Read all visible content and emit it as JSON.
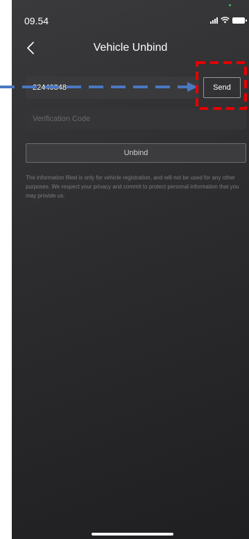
{
  "status_bar": {
    "time": "09.54",
    "icons": [
      "signal-icon",
      "wifi-icon",
      "battery-icon"
    ]
  },
  "nav": {
    "title": "Vehicle Unbind",
    "back_icon": "chevron-left-icon"
  },
  "form": {
    "phone_value": "22440848",
    "send_label": "Send",
    "code_placeholder": "Verification Code",
    "code_value": "",
    "unbind_label": "Unbind"
  },
  "privacy_note": "The information filled is only for vehicle registration, and will not be used for any other purposes. We respect your privacy and commit to protect personal information that you may provide us.",
  "colors": {
    "background": "#2c2c2e",
    "input_background": "#3a3a3c",
    "annotation_arrow": "#4a78c2",
    "annotation_box": "#e60000"
  }
}
